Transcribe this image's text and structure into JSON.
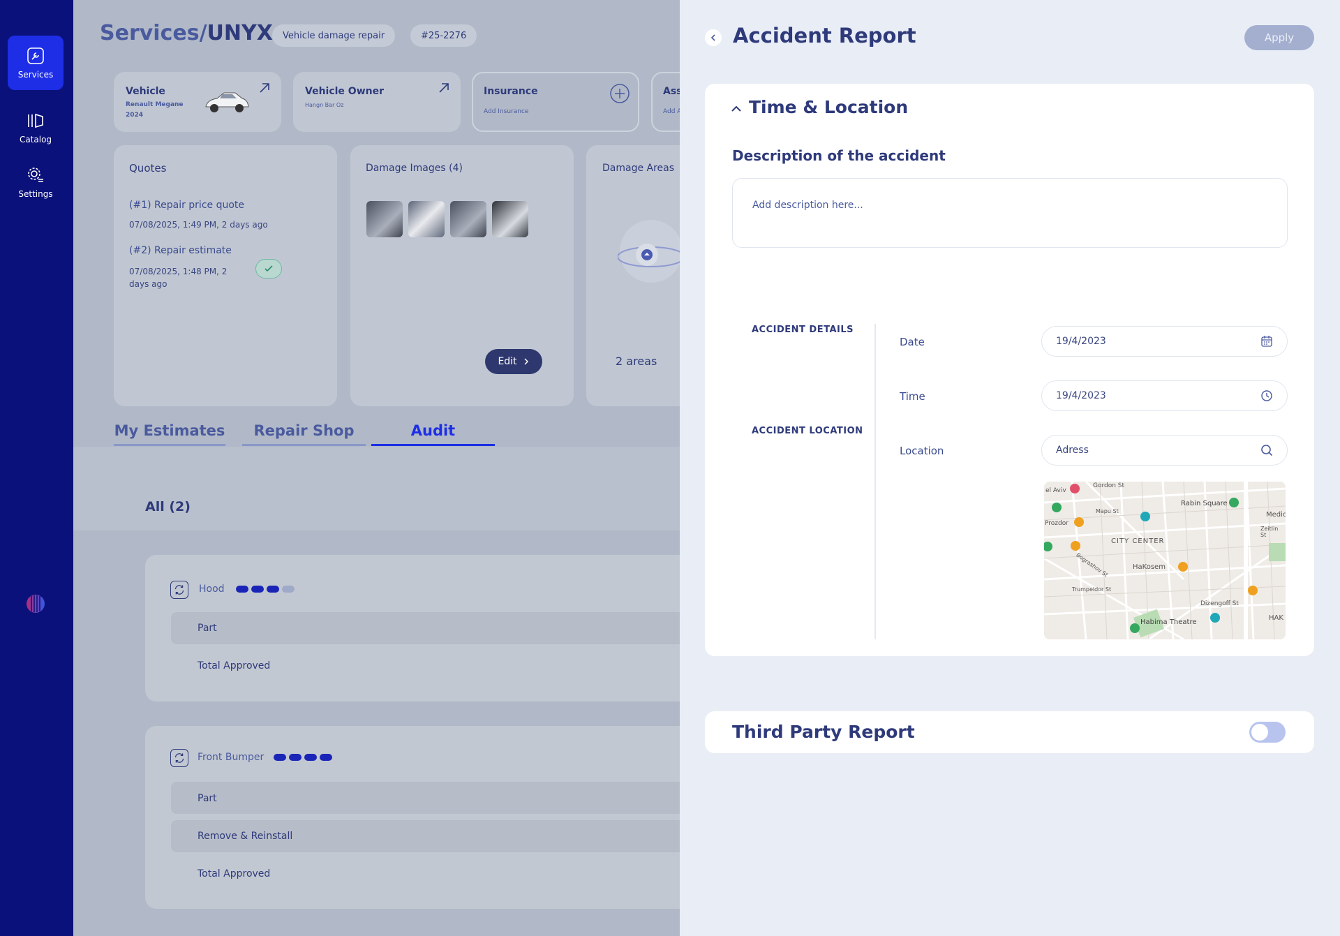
{
  "sidebar": {
    "items": [
      {
        "label": "Services",
        "icon": "wrench-icon",
        "active": true
      },
      {
        "label": "Catalog",
        "icon": "catalog-icon",
        "active": false
      },
      {
        "label": "Settings",
        "icon": "settings-icon",
        "active": false
      }
    ]
  },
  "header": {
    "title_prefix": "Services/",
    "title_main": "UNYX",
    "chip_service": "Vehicle damage repair",
    "chip_id": "#25-2276"
  },
  "info_cards": {
    "vehicle": {
      "title": "Vehicle",
      "model": "Renault Megane",
      "year": "2024"
    },
    "owner": {
      "title": "Vehicle Owner",
      "name": "Hangn Bar Oz"
    },
    "insurance": {
      "title": "Insurance",
      "action": "Add Insurance"
    },
    "assessor": {
      "title": "Ass",
      "action": "Add A"
    }
  },
  "quotes": {
    "title": "Quotes",
    "items": [
      {
        "name": "(#1) Repair price quote",
        "date": "07/08/2025, 1:49 PM, 2 days ago"
      },
      {
        "name": "(#2) Repair estimate",
        "date": "07/08/2025, 1:48 PM, 2 days ago"
      }
    ]
  },
  "damage_images": {
    "title": "Damage Images (4)",
    "edit_label": "Edit"
  },
  "damage_areas": {
    "title": "Damage Areas",
    "summary": "2 areas"
  },
  "tabs": [
    {
      "label": "My Estimates",
      "active": false
    },
    {
      "label": "Repair Shop",
      "active": false
    },
    {
      "label": "Audit",
      "active": true
    }
  ],
  "list": {
    "filter_label": "All (2)",
    "groups": [
      {
        "name": "Hood",
        "level_filled": 3,
        "level_total": 4,
        "rows": [
          "Part",
          "Total Approved"
        ]
      },
      {
        "name": "Front Bumper",
        "level_filled": 4,
        "level_total": 4,
        "rows": [
          "Part",
          "Remove & Reinstall",
          "Total Approved"
        ]
      }
    ]
  },
  "panel": {
    "title": "Accident Report",
    "apply_label": "Apply",
    "time_location": {
      "section_title": "Time & Location",
      "description_label": "Description of the accident",
      "description_placeholder": "Add description here...",
      "details_heading": "ACCIDENT DETAILS",
      "location_heading": "ACCIDENT LOCATION",
      "date_label": "Date",
      "date_value": "19/4/2023",
      "time_label": "Time",
      "time_value": "19/4/2023",
      "location_label": "Location",
      "location_placeholder": "Adress"
    },
    "map_labels": {
      "aviv": "el Aviv",
      "gordon": "Gordon St",
      "mapu": "Mapu St",
      "rabin": "Rabin Square",
      "prozdor": "Prozdor",
      "city_center": "CITY CENTER",
      "hakosem": "HaKosem",
      "bograshov": "Bograshov St",
      "trumpeldor": "Trumpeldor St",
      "dizengoff": "Dizengoff St",
      "habima": "Habima Theatre",
      "medic": "Medic",
      "zeitlin": "Zeitlin St",
      "hak": "HAK"
    },
    "third_party": {
      "title": "Third Party Report",
      "enabled": false
    }
  },
  "colors": {
    "sidebar_bg": "#0b117a",
    "accent": "#1d2ee6",
    "title_text": "#2e3a7a",
    "panel_bg": "#e9eef6"
  }
}
